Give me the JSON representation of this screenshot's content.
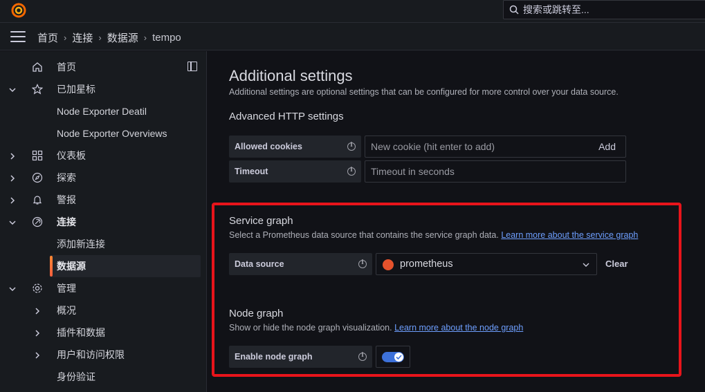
{
  "topbar": {
    "search_placeholder": "搜索或跳转至..."
  },
  "breadcrumb": {
    "items": [
      "首页",
      "连接",
      "数据源"
    ],
    "current": "tempo",
    "separator": "›"
  },
  "sidebar": {
    "items": [
      {
        "label": "首页",
        "icon": "home-icon"
      },
      {
        "label": "已加星标",
        "icon": "star-icon",
        "expanded": true
      },
      {
        "label": "Node Exporter Deatil"
      },
      {
        "label": "Node Exporter Overviews"
      },
      {
        "label": "仪表板",
        "icon": "dashboards-icon"
      },
      {
        "label": "探索",
        "icon": "compass-icon"
      },
      {
        "label": "警报",
        "icon": "bell-icon"
      },
      {
        "label": "连接",
        "icon": "connections-icon",
        "expanded": true
      },
      {
        "label": "添加新连接"
      },
      {
        "label": "数据源",
        "active": true
      },
      {
        "label": "管理",
        "icon": "gear-icon",
        "expanded": true
      },
      {
        "label": "概况"
      },
      {
        "label": "插件和数据"
      },
      {
        "label": "用户和访问权限"
      },
      {
        "label": "身份验证"
      }
    ]
  },
  "main": {
    "title": "Additional settings",
    "subtitle": "Additional settings are optional settings that can be configured for more control over your data source.",
    "http": {
      "heading": "Advanced HTTP settings",
      "cookies_label": "Allowed cookies",
      "cookies_placeholder": "New cookie (hit enter to add)",
      "cookies_add": "Add",
      "timeout_label": "Timeout",
      "timeout_placeholder": "Timeout in seconds"
    },
    "service_graph": {
      "heading": "Service graph",
      "desc": "Select a Prometheus data source that contains the service graph data.",
      "link": "Learn more about the service graph",
      "datasource_label": "Data source",
      "datasource_value": "prometheus",
      "clear": "Clear"
    },
    "node_graph": {
      "heading": "Node graph",
      "desc": "Show or hide the node graph visualization.",
      "link": "Learn more about the node graph",
      "toggle_label": "Enable node graph",
      "enabled": true
    }
  },
  "colors": {
    "accent": "#3d71d9",
    "highlight_box": "#e8141b",
    "link": "#6e9fff",
    "active_bar": "#f55f3e"
  }
}
